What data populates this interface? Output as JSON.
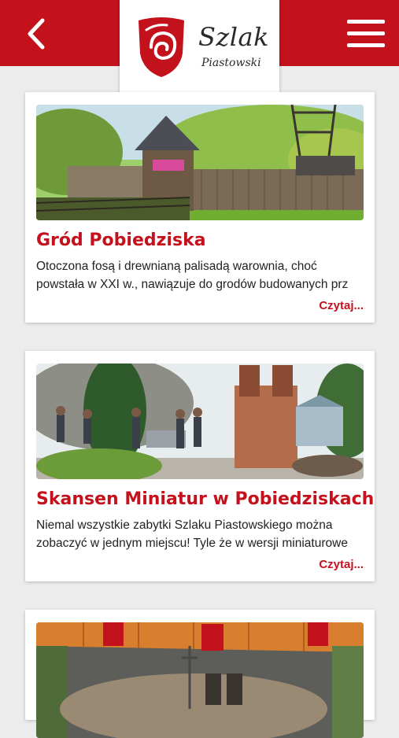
{
  "header": {
    "back_icon": "chevron-left-icon",
    "menu_icon": "hamburger-menu-icon",
    "logo_title": "Szlak",
    "logo_subtitle": "Piastowski"
  },
  "colors": {
    "brand_red": "#c4121d"
  },
  "articles": [
    {
      "title": "Gród Pobiedziska",
      "excerpt_line1": "Otoczona fosą i drewnianą palisadą warownia, choć",
      "excerpt_line2": "powstała w XXI w., nawiązuje do grodów budowanych prz",
      "read_more": "Czytaj..."
    },
    {
      "title": "Skansen Miniatur w Pobiedziskach",
      "excerpt_line1": "Niemal wszystkie zabytki Szlaku Piastowskiego można",
      "excerpt_line2": "zobaczyć w jednym miejscu! Tyle że w wersji miniaturowe",
      "read_more": "Czytaj..."
    },
    {
      "title": "",
      "excerpt_line1": "",
      "excerpt_line2": "",
      "read_more": ""
    }
  ]
}
